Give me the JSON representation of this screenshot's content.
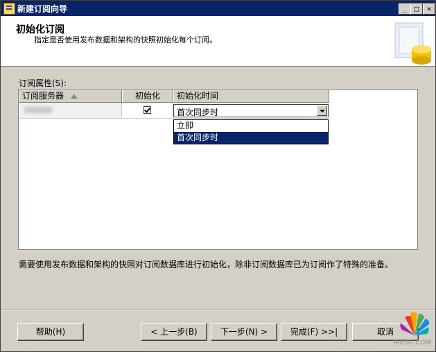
{
  "window": {
    "title": "新建订阅向导",
    "min_label": "_",
    "max_label": "□",
    "close_label": "×"
  },
  "header": {
    "title": "初始化订阅",
    "subtitle": "指定是否使用发布数据和架构的快照初始化每个订阅。"
  },
  "grid": {
    "label": "订阅属性(S):",
    "columns": [
      "订阅服务器",
      "初始化",
      "初始化时间"
    ],
    "rows": [
      {
        "subscriber": "",
        "initialize": true,
        "init_time": "首次同步时"
      }
    ],
    "dropdown_options": [
      "立即",
      "首次同步时"
    ],
    "dropdown_selected": "首次同步时"
  },
  "description": "需要使用发布数据和架构的快照对订阅数据库进行初始化，除非订阅数据库已为订阅作了特殊的准备。",
  "buttons": {
    "help": "帮助(H)",
    "back": "< 上一步(B)",
    "next": "下一步(N) >",
    "finish": "完成(F) >>|",
    "cancel": "取消"
  },
  "watermark": "M8SU.COM",
  "colors": {
    "title_bar": "#0a246a",
    "selection": "#0a246a",
    "face": "#d4d0c8"
  }
}
